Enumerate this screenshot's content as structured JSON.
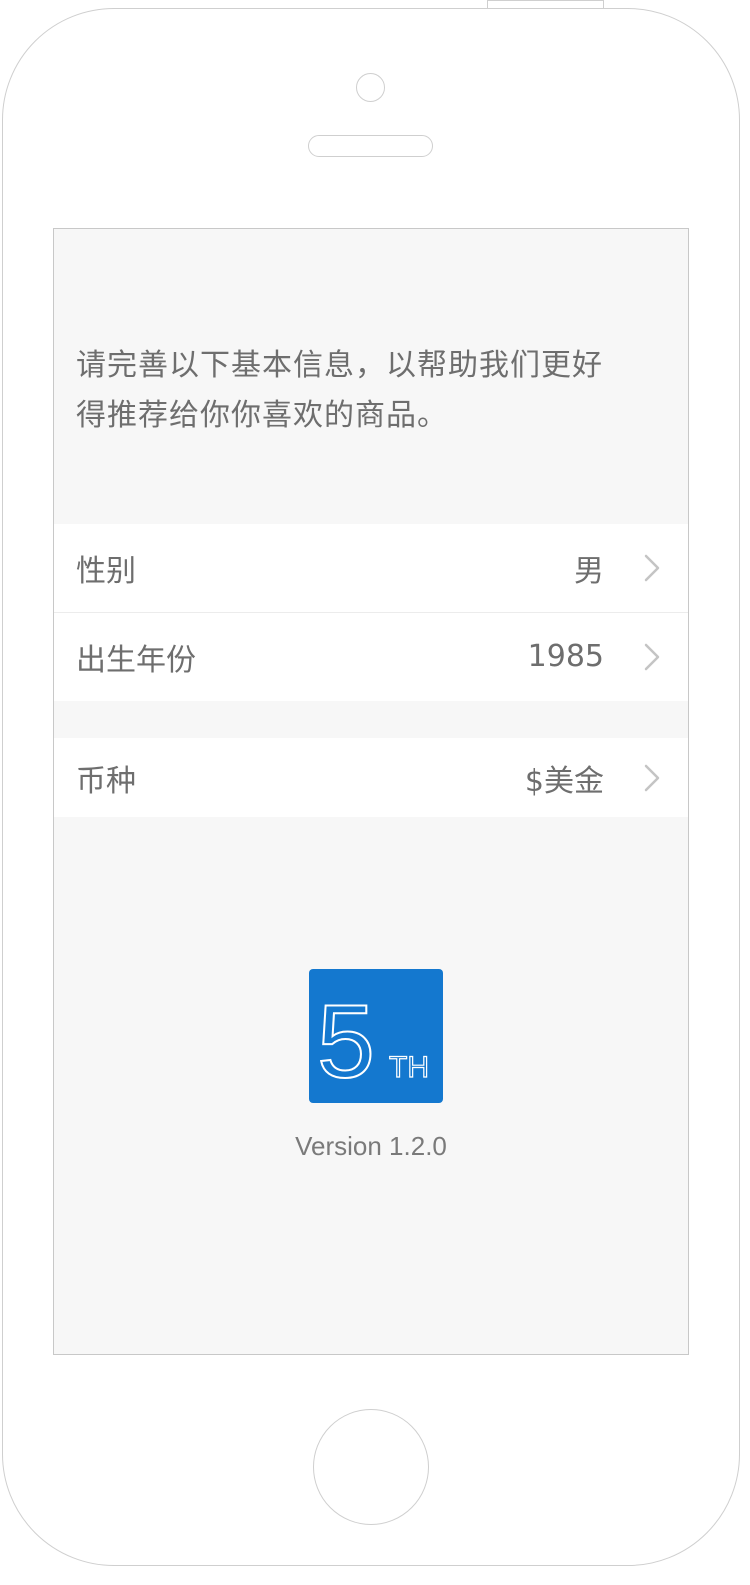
{
  "intro": {
    "line1": "请完善以下基本信息，以帮助我们更好",
    "line2": "得推荐给你你喜欢的商品。"
  },
  "settings": {
    "gender": {
      "label": "性别",
      "value": "男"
    },
    "birth_year": {
      "label": "出生年份",
      "value": "1985"
    },
    "currency": {
      "label": "币种",
      "value": "$美金"
    }
  },
  "logo": {
    "numeral": "5",
    "suffix": "TH",
    "color": "#1478cf"
  },
  "footer": {
    "version": "Version 1.2.0"
  },
  "icons": {
    "row_arrow": "chevron-right-icon"
  }
}
